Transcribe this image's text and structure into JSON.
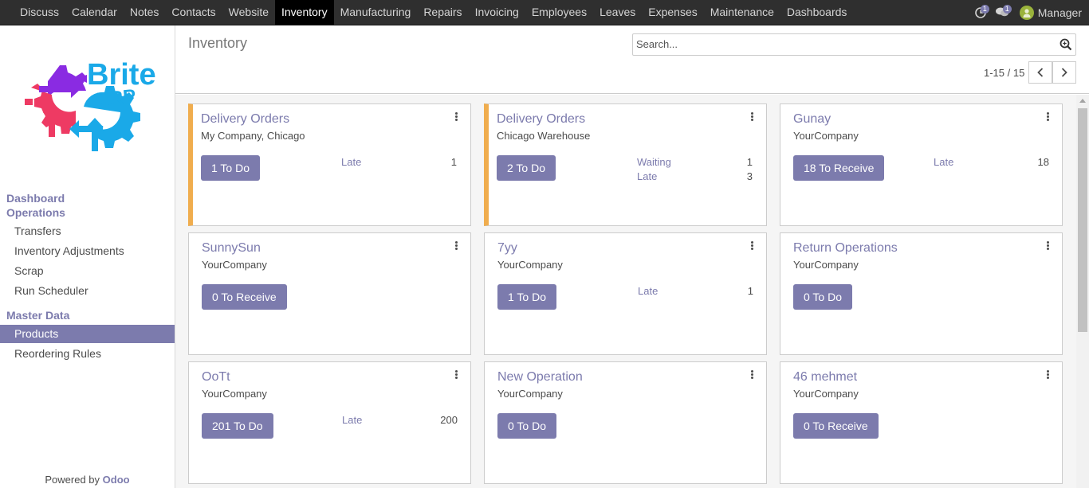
{
  "topbar": {
    "menu": [
      {
        "label": "Discuss",
        "name": "menu-discuss"
      },
      {
        "label": "Calendar",
        "name": "menu-calendar"
      },
      {
        "label": "Notes",
        "name": "menu-notes"
      },
      {
        "label": "Contacts",
        "name": "menu-contacts"
      },
      {
        "label": "Website",
        "name": "menu-website"
      },
      {
        "label": "Inventory",
        "name": "menu-inventory",
        "active": true
      },
      {
        "label": "Manufacturing",
        "name": "menu-manufacturing"
      },
      {
        "label": "Repairs",
        "name": "menu-repairs"
      },
      {
        "label": "Invoicing",
        "name": "menu-invoicing"
      },
      {
        "label": "Employees",
        "name": "menu-employees"
      },
      {
        "label": "Leaves",
        "name": "menu-leaves"
      },
      {
        "label": "Expenses",
        "name": "menu-expenses"
      },
      {
        "label": "Maintenance",
        "name": "menu-maintenance"
      },
      {
        "label": "Dashboards",
        "name": "menu-dashboards"
      }
    ],
    "activity_count": "1",
    "messages_count": "1",
    "user": "Manager"
  },
  "sidebar": {
    "logo": {
      "text_top": "Brite",
      "text_bottom": "ERP"
    },
    "sections": [
      {
        "label": "Dashboard",
        "name": "sidebar-section-dashboard"
      },
      {
        "label": "Operations",
        "name": "sidebar-section-operations"
      },
      {
        "label": "Master Data",
        "name": "sidebar-section-master-data"
      }
    ],
    "items": [
      {
        "label": "Transfers",
        "name": "sidebar-item-transfers"
      },
      {
        "label": "Inventory Adjustments",
        "name": "sidebar-item-inventory-adjustments"
      },
      {
        "label": "Scrap",
        "name": "sidebar-item-scrap"
      },
      {
        "label": "Run Scheduler",
        "name": "sidebar-item-run-scheduler"
      },
      {
        "label": "Products",
        "name": "sidebar-item-products",
        "active": true
      },
      {
        "label": "Reordering Rules",
        "name": "sidebar-item-reordering-rules"
      }
    ],
    "powered_prefix": "Powered by ",
    "powered_brand": "Odoo"
  },
  "control": {
    "title": "Inventory",
    "search_placeholder": "Search...",
    "pager": "1-15 / 15"
  },
  "cards": [
    {
      "name": "Delivery Orders",
      "company": "My Company, Chicago",
      "button": "1 To Do",
      "warn": true,
      "stats": [
        {
          "label": "Late",
          "value": "1"
        }
      ]
    },
    {
      "name": "Delivery Orders",
      "company": "Chicago Warehouse",
      "button": "2 To Do",
      "warn": true,
      "stats": [
        {
          "label": "Waiting",
          "value": "1"
        },
        {
          "label": "Late",
          "value": "3"
        }
      ]
    },
    {
      "name": "Gunay",
      "company": "YourCompany",
      "button": "18 To Receive",
      "warn": false,
      "stats": [
        {
          "label": "Late",
          "value": "18"
        }
      ]
    },
    {
      "name": "SunnySun",
      "company": "YourCompany",
      "button": "0 To Receive",
      "warn": false,
      "stats": []
    },
    {
      "name": "7yy",
      "company": "YourCompany",
      "button": "1 To Do",
      "warn": false,
      "stats": [
        {
          "label": "Late",
          "value": "1"
        }
      ]
    },
    {
      "name": "Return Operations",
      "company": "YourCompany",
      "button": "0 To Do",
      "warn": false,
      "stats": []
    },
    {
      "name": "OoTt",
      "company": "YourCompany",
      "button": "201 To Do",
      "warn": false,
      "stats": [
        {
          "label": "Late",
          "value": "200"
        }
      ]
    },
    {
      "name": "New Operation",
      "company": "YourCompany",
      "button": "0 To Do",
      "warn": false,
      "stats": []
    },
    {
      "name": "46 mehmet",
      "company": "YourCompany",
      "button": "0 To Receive",
      "warn": false,
      "stats": []
    }
  ],
  "colors": {
    "accent": "#7c7bad",
    "navbar": "#2f2f2f",
    "warning": "#f0ad4e"
  }
}
